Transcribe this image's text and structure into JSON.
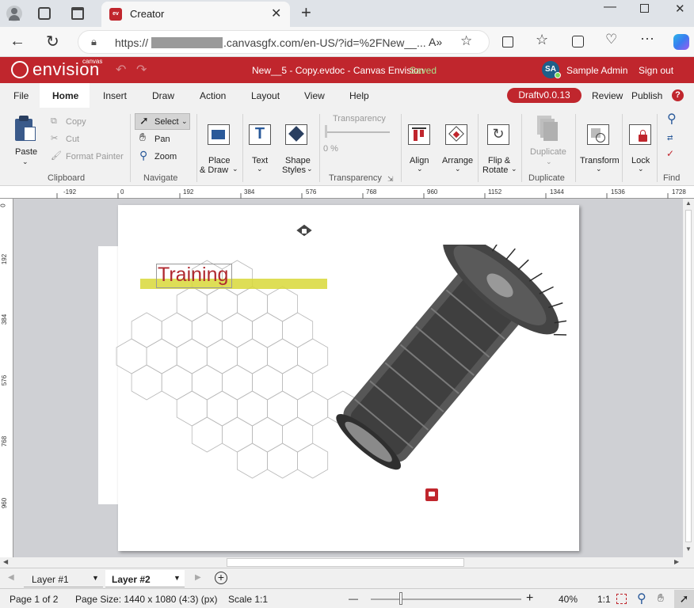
{
  "browser": {
    "tab_title": "Creator",
    "url_prefix": "https://",
    "url_domain": ".canvasgfx.com/en-US/?id=%2FNew__...",
    "read_aloud": "A»"
  },
  "app": {
    "logo_text": "envision",
    "logo_sub": "canvas",
    "doc_title": "New__5 - Copy.evdoc - Canvas Envision",
    "save_status": "Saved",
    "user_initials": "SA",
    "user_name": "Sample Admin",
    "sign_out": "Sign out"
  },
  "menu": {
    "items": [
      "File",
      "Home",
      "Insert",
      "Draw",
      "Action",
      "Layout",
      "View",
      "Help"
    ],
    "active": "Home",
    "draft_badge": "Draftv0.0.13",
    "review": "Review",
    "publish": "Publish",
    "help_glyph": "?"
  },
  "ribbon": {
    "clipboard": {
      "paste": "Paste",
      "copy": "Copy",
      "cut": "Cut",
      "format_painter": "Format Painter",
      "label": "Clipboard"
    },
    "navigate": {
      "select": "Select",
      "pan": "Pan",
      "zoom": "Zoom",
      "label": "Navigate"
    },
    "place_draw": {
      "line1": "Place",
      "line2": "& Draw"
    },
    "text": {
      "label": "Text"
    },
    "shape_styles": {
      "line1": "Shape",
      "line2": "Styles"
    },
    "transparency": {
      "title": "Transparency",
      "value": "0 %",
      "label": "Transparency"
    },
    "align": {
      "label": "Align"
    },
    "arrange": {
      "label": "Arrange"
    },
    "flip_rotate": {
      "line1": "Flip &",
      "line2": "Rotate"
    },
    "duplicate": {
      "button": "Duplicate",
      "label": "Duplicate"
    },
    "transform": {
      "label": "Transform"
    },
    "lock": {
      "label": "Lock"
    },
    "find": {
      "label": "Find"
    }
  },
  "ruler": {
    "h_ticks": [
      "-192",
      "0",
      "192",
      "384",
      "576",
      "768",
      "960",
      "1152",
      "1344",
      "1536",
      "1728"
    ],
    "v_ticks": [
      "0",
      "192",
      "384",
      "576",
      "768",
      "960"
    ]
  },
  "canvas": {
    "training_label": "Training"
  },
  "layers": {
    "layer1": "Layer #1",
    "layer2": "Layer #2"
  },
  "status": {
    "page": "Page 1 of 2",
    "page_size": "Page Size: 1440 x 1080 (4:3) (px)",
    "scale": "Scale 1:1",
    "zoom_minus": "—",
    "zoom_plus": "+",
    "zoom_pct": "40%",
    "one_to_one": "1:1",
    "zoom_fraction": 0.2
  },
  "colors": {
    "brand": "#c0262d",
    "saved_green": "#a8e08a",
    "training_text": "#b02a30",
    "highlight": "#d8d838"
  }
}
